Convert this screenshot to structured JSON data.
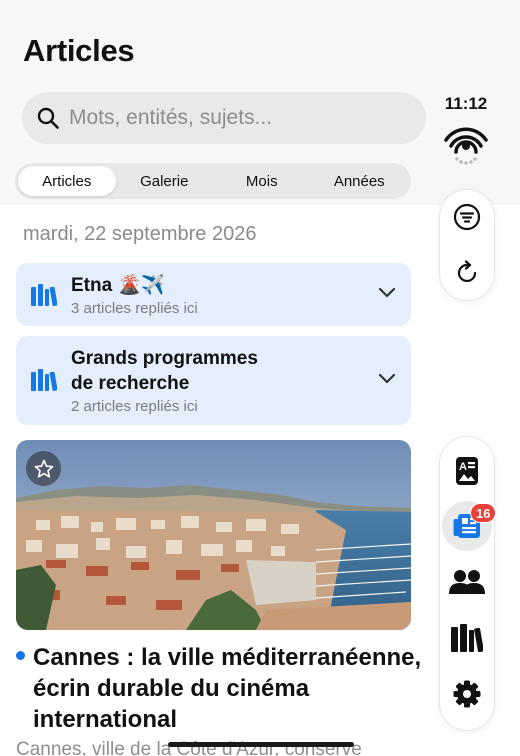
{
  "header": {
    "title": "Articles"
  },
  "search": {
    "placeholder": "Mots, entités, sujets..."
  },
  "tabs": [
    {
      "label": "Articles",
      "active": true
    },
    {
      "label": "Galerie",
      "active": false
    },
    {
      "label": "Mois",
      "active": false
    },
    {
      "label": "Années",
      "active": false
    }
  ],
  "status": {
    "time": "11:12"
  },
  "side_toolbar_top": {
    "icons": [
      "filter-icon",
      "refresh-icon"
    ]
  },
  "side_toolbar_bottom": {
    "icons": [
      "reader-icon",
      "news-icon",
      "people-icon",
      "library-icon",
      "gear-icon"
    ],
    "news_badge": "16",
    "selected": "news-icon"
  },
  "feed": {
    "date_heading": "mardi, 22 septembre 2026",
    "groups": [
      {
        "title": "Etna 🌋✈️",
        "subtitle": "3 articles repliés ici"
      },
      {
        "title_line1": "Grands programmes",
        "title_line2": "de recherche",
        "subtitle": "2 articles repliés ici"
      }
    ],
    "article": {
      "headline": "Cannes : la ville méditerranéenne, écrin durable du cinéma international",
      "excerpt": "Cannes, ville de la Côte d'Azur, conserve"
    }
  },
  "colors": {
    "accent": "#1677e8",
    "group_card_bg": "#e4eefc",
    "badge": "#e8403b"
  }
}
